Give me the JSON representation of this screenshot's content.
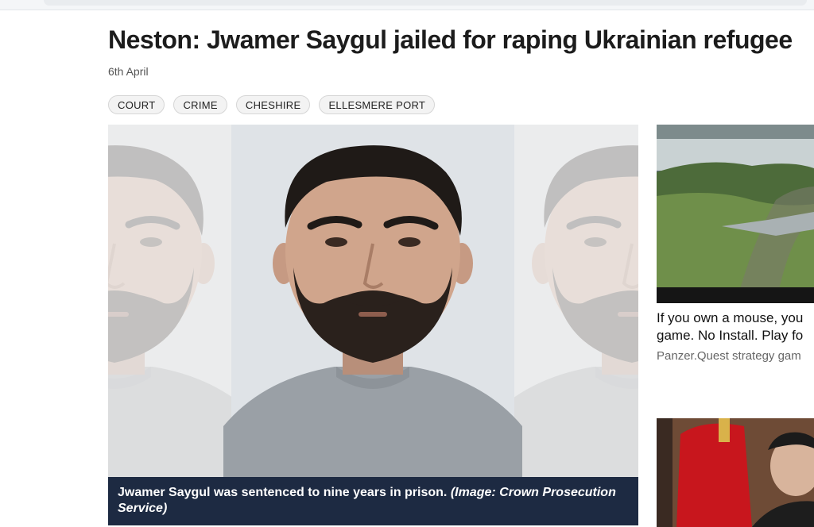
{
  "article": {
    "headline": "Neston: Jwamer Saygul jailed for raping Ukrainian refugee",
    "date": "6th April",
    "tags": [
      "COURT",
      "CRIME",
      "CHESHIRE",
      "ELLESMERE PORT"
    ],
    "caption": "Jwamer Saygul was sentenced to nine years in prison.",
    "credit": "(Image: Crown Prosecution Service)"
  },
  "sidebar": {
    "ad": {
      "title_line1": "If you own a mouse, you",
      "title_line2": "game. No Install. Play fo",
      "source": "Panzer.Quest strategy gam"
    }
  },
  "colors": {
    "caption_bg": "#1d2a42",
    "tag_bg": "#f3f3f3"
  }
}
